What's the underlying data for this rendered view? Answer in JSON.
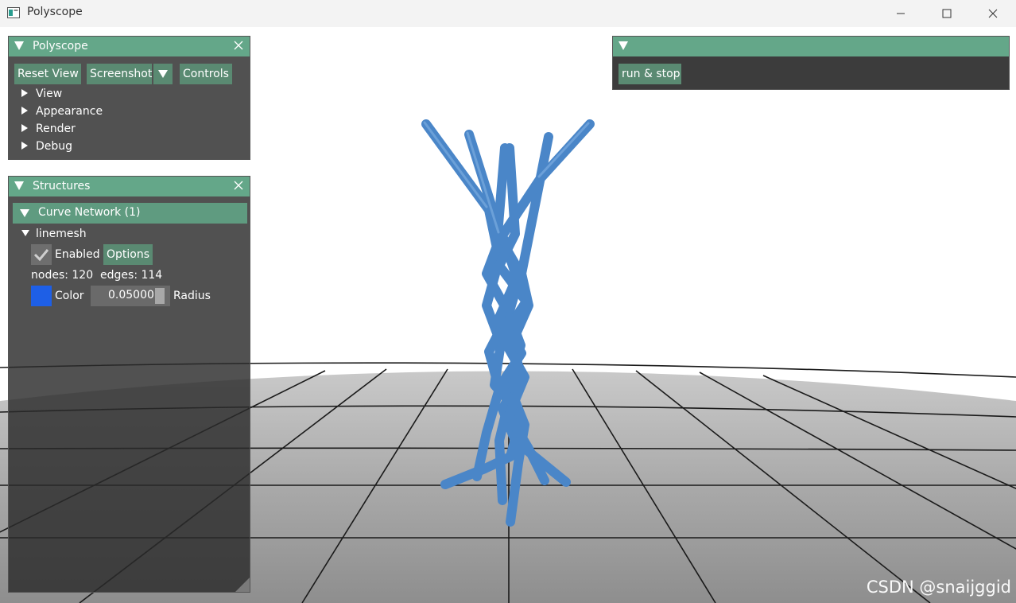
{
  "window": {
    "title": "Polyscope"
  },
  "polyscope_panel": {
    "title": "Polyscope",
    "buttons": {
      "reset_view": "Reset View",
      "screenshot": "Screenshot",
      "controls": "Controls"
    },
    "tree": [
      "View",
      "Appearance",
      "Render",
      "Debug"
    ]
  },
  "structures_panel": {
    "title": "Structures",
    "group_title": "Curve Network (1)",
    "item_name": "linemesh",
    "enabled_label": "Enabled",
    "options_label": "Options",
    "stats": "nodes: 120  edges: 114",
    "color_label": "Color",
    "radius_value": "0.05000",
    "radius_label": "Radius"
  },
  "user_panel": {
    "run_stop_label": "run & stop"
  },
  "watermark": "CSDN @snaijggid",
  "colors": {
    "accent": "#64a789",
    "button": "#5a8a72",
    "curve": "#4a86c8",
    "swatch": "#1e5fe6"
  }
}
